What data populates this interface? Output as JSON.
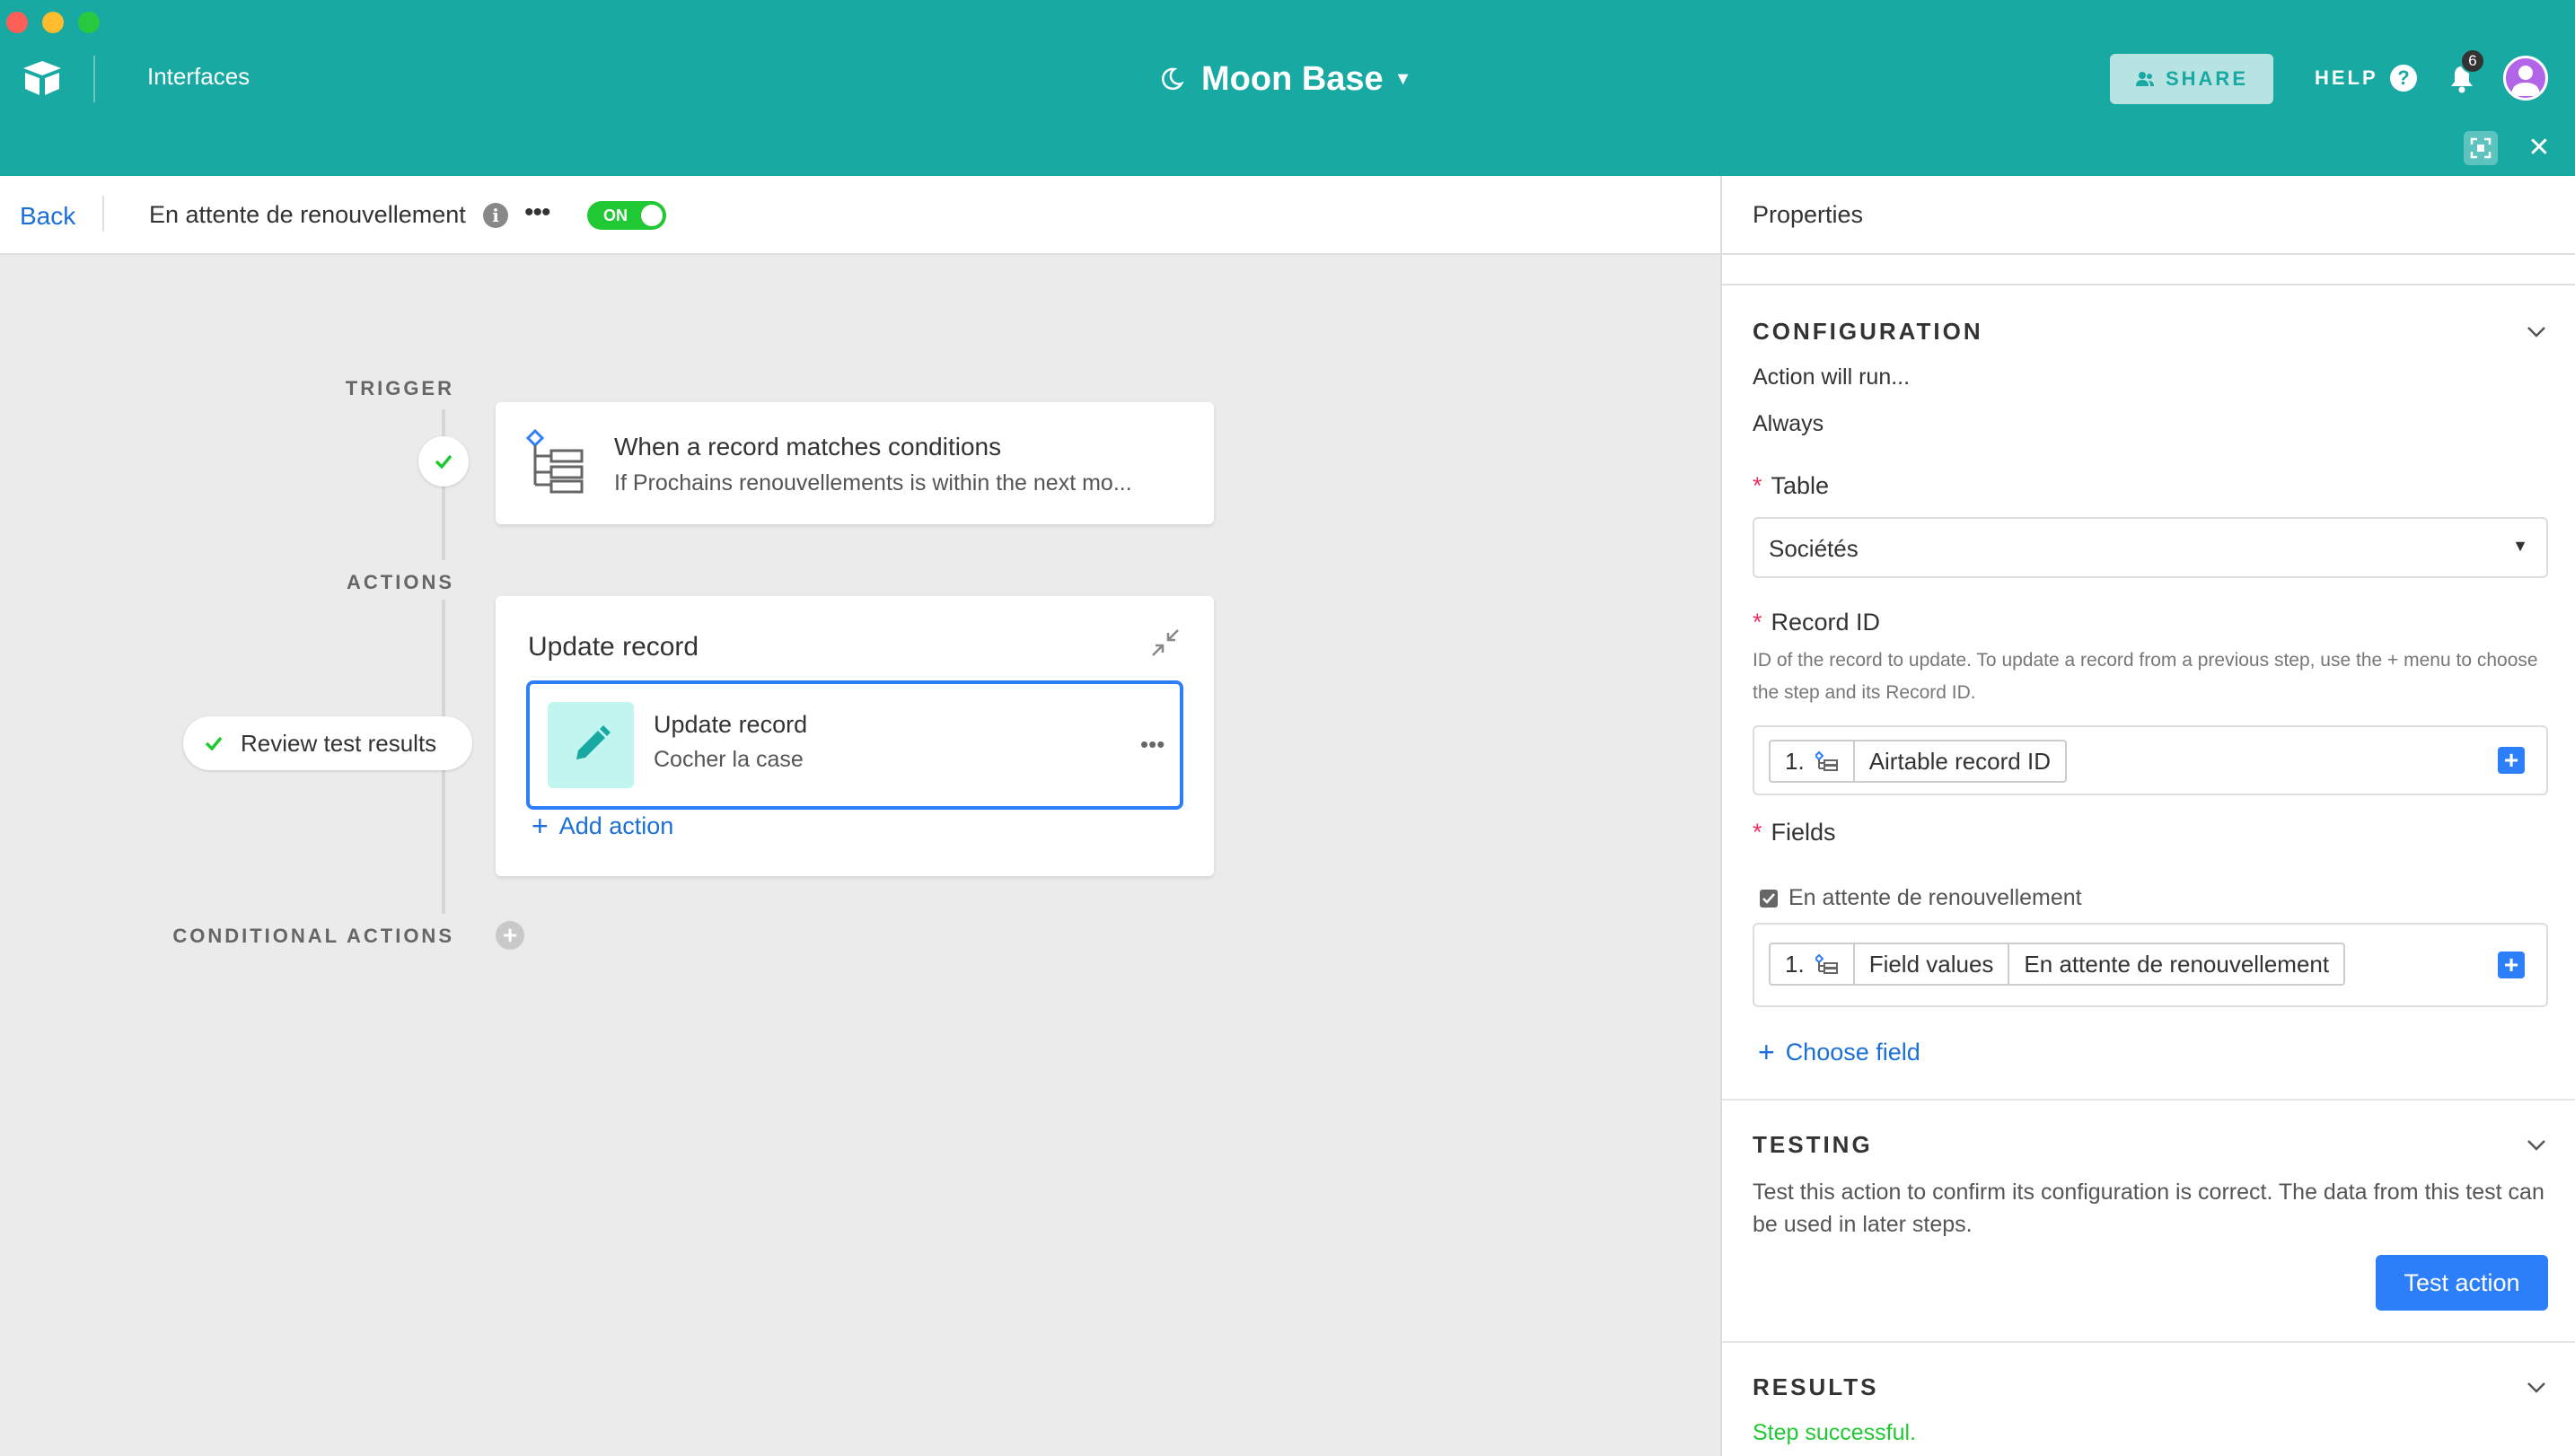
{
  "topbar": {
    "interfaces_label": "Interfaces",
    "base_name": "Moon Base",
    "share_label": "SHARE",
    "help_label": "HELP",
    "help_glyph": "?",
    "notification_count": "6",
    "accent_color": "#18a9a3"
  },
  "automation": {
    "back_label": "Back",
    "name": "En attente de renouvellement",
    "toggle_label": "ON"
  },
  "canvas": {
    "trigger_label": "TRIGGER",
    "actions_label": "ACTIONS",
    "conditional_actions_label": "CONDITIONAL ACTIONS",
    "trigger_title": "When a record matches conditions",
    "trigger_subtitle": "If Prochains renouvellements is within the next mo...",
    "actions_card_title": "Update record",
    "action_title": "Update record",
    "action_subtitle": "Cocher la case",
    "add_action_label": "Add action",
    "review_label": "Review test results"
  },
  "properties": {
    "title": "Properties",
    "configuration_heading": "CONFIGURATION",
    "action_will_run": "Action will run...",
    "run_mode": "Always",
    "table_label": "Table",
    "table_value": "Sociétés",
    "record_id_label": "Record ID",
    "record_id_help": "ID of the record to update. To update a record from a previous step, use the + menu to choose the step and its Record ID.",
    "record_token": {
      "step": "1.",
      "field": "Airtable record ID"
    },
    "fields_label": "Fields",
    "field_name": "En attente de renouvellement",
    "field_token": {
      "step": "1.",
      "source": "Field values",
      "field": "En attente de renouvellement"
    },
    "choose_field_label": "Choose field",
    "testing_heading": "TESTING",
    "testing_text": "Test this action to confirm its configuration is correct. The data from this test can be used in later steps.",
    "test_button_label": "Test action",
    "results_heading": "RESULTS",
    "results_status": "Step successful."
  }
}
